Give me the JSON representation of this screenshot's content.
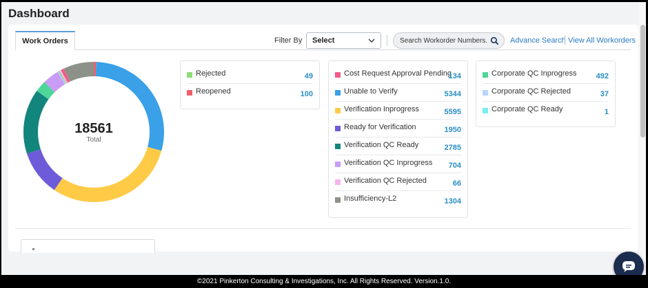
{
  "page": {
    "title": "Dashboard"
  },
  "tabs": [
    {
      "label": "Work Orders",
      "active": true
    }
  ],
  "filter": {
    "label": "Filter By",
    "select_value": "Select",
    "search_placeholder": "Search Workorder Numbers.",
    "links": {
      "advance_search": "Advance Search",
      "view_all": "View All Workorders"
    }
  },
  "summary": {
    "total": "18561",
    "total_label": "Total"
  },
  "chart_data": {
    "type": "pie",
    "variant": "donut",
    "total": 18561,
    "categories": [
      "Reopened",
      "Unable to Verify",
      "Verification Inprogress",
      "Ready for Verification",
      "Verification QC Ready",
      "Corporate QC Inprogress",
      "Verification QC Inprogress",
      "Corporate QC Rejected",
      "Corporate QC Ready",
      "Rejected",
      "Verification QC Rejected",
      "Cost Request Approval Pending",
      "Insufficiency-L2"
    ],
    "values": [
      100,
      5344,
      5595,
      1950,
      2785,
      492,
      704,
      37,
      1,
      49,
      66,
      134,
      1304
    ],
    "colors": [
      "#ef5f6a",
      "#3aa0e8",
      "#ffcb47",
      "#6d5bd9",
      "#12857d",
      "#4ed69a",
      "#c99cf5",
      "#b5d6fa",
      "#78eef0",
      "#8ddc77",
      "#f7b3f1",
      "#f25b8a",
      "#8c9287"
    ]
  },
  "legend_panels": [
    {
      "items": [
        {
          "label": "Rejected",
          "value": "49",
          "color": "#8ddc77"
        },
        {
          "label": "Reopened",
          "value": "100",
          "color": "#ef5f6a"
        }
      ]
    },
    {
      "items": [
        {
          "label": "Cost Request Approval Pending",
          "value": "134",
          "color": "#f25b8a"
        },
        {
          "label": "Unable to Verify",
          "value": "5344",
          "color": "#3aa0e8"
        },
        {
          "label": "Verification Inprogress",
          "value": "5595",
          "color": "#ffcb47"
        },
        {
          "label": "Ready for Verification",
          "value": "1950",
          "color": "#6d5bd9"
        },
        {
          "label": "Verification QC Ready",
          "value": "2785",
          "color": "#12857d"
        },
        {
          "label": "Verification QC Inprogress",
          "value": "704",
          "color": "#c99cf5"
        },
        {
          "label": "Verification QC Rejected",
          "value": "66",
          "color": "#f7b3f1"
        },
        {
          "label": "Insufficiency-L2",
          "value": "1304",
          "color": "#8c9287"
        }
      ]
    },
    {
      "items": [
        {
          "label": "Corporate QC Inprogress",
          "value": "492",
          "color": "#4ed69a"
        },
        {
          "label": "Corporate QC Rejected",
          "value": "37",
          "color": "#b5d6fa"
        },
        {
          "label": "Corporate QC Ready",
          "value": "1",
          "color": "#78eef0"
        }
      ]
    }
  ],
  "footer": {
    "text": "©2021 Pinkerton Consulting & Investigations, Inc. All Rights Reserved. Version.1.0."
  },
  "icons": {
    "chevron": "chevron-down-icon",
    "search": "search-icon",
    "chat": "chat-icon"
  }
}
